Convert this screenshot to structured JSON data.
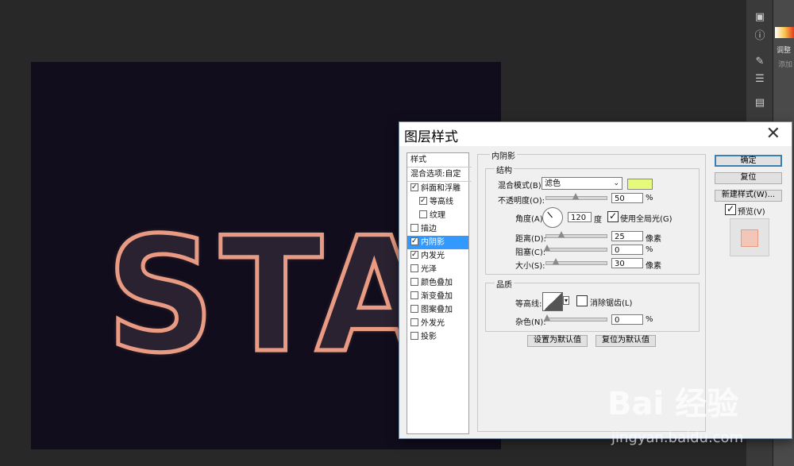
{
  "canvas": {
    "text": "STAR"
  },
  "right_panel": {
    "title": "调整",
    "subtitle": "添加",
    "tools": [
      "adjust-icon",
      "info-icon",
      "brush-icon",
      "sliders-icon",
      "stamp-icon"
    ]
  },
  "dialog": {
    "title": "图层样式",
    "close": "✕",
    "styles_header": "样式",
    "blend_options": "混合选项:自定",
    "styles": [
      {
        "label": "斜面和浮雕",
        "checked": true,
        "sub": false,
        "selected": false
      },
      {
        "label": "等高线",
        "checked": true,
        "sub": true,
        "selected": false
      },
      {
        "label": "纹理",
        "checked": false,
        "sub": true,
        "selected": false
      },
      {
        "label": "描边",
        "checked": false,
        "sub": false,
        "selected": false
      },
      {
        "label": "内阴影",
        "checked": true,
        "sub": false,
        "selected": true
      },
      {
        "label": "内发光",
        "checked": true,
        "sub": false,
        "selected": false
      },
      {
        "label": "光泽",
        "checked": false,
        "sub": false,
        "selected": false
      },
      {
        "label": "颜色叠加",
        "checked": false,
        "sub": false,
        "selected": false
      },
      {
        "label": "渐变叠加",
        "checked": false,
        "sub": false,
        "selected": false
      },
      {
        "label": "图案叠加",
        "checked": false,
        "sub": false,
        "selected": false
      },
      {
        "label": "外发光",
        "checked": false,
        "sub": false,
        "selected": false
      },
      {
        "label": "投影",
        "checked": false,
        "sub": false,
        "selected": false
      }
    ],
    "section_title": "内阴影",
    "structure": {
      "title": "结构",
      "blend_mode_label": "混合模式(B):",
      "blend_mode_value": "滤色",
      "blend_color": "#e5f97a",
      "opacity_label": "不透明度(O):",
      "opacity_value": "50",
      "percent": "%",
      "angle_label": "角度(A):",
      "angle_value": "120",
      "angle_unit": "度",
      "global_light_label": "使用全局光(G)",
      "global_light_checked": "✓",
      "distance_label": "距离(D):",
      "distance_value": "25",
      "choke_label": "阻塞(C):",
      "choke_value": "0",
      "size_label": "大小(S):",
      "size_value": "30",
      "pixel_unit": "像素"
    },
    "quality": {
      "title": "品质",
      "contour_label": "等高线:",
      "antialias_label": "消除锯齿(L)",
      "noise_label": "杂色(N):",
      "noise_value": "0"
    },
    "set_default": "设置为默认值",
    "reset_default": "复位为默认值",
    "ok": "确定",
    "reset": "复位",
    "new_style": "新建样式(W)...",
    "preview_label": "预览(V)",
    "preview_checked": "✓"
  },
  "watermark": {
    "brand": "Bai 经验",
    "url": "jingyan.baidu.com"
  }
}
